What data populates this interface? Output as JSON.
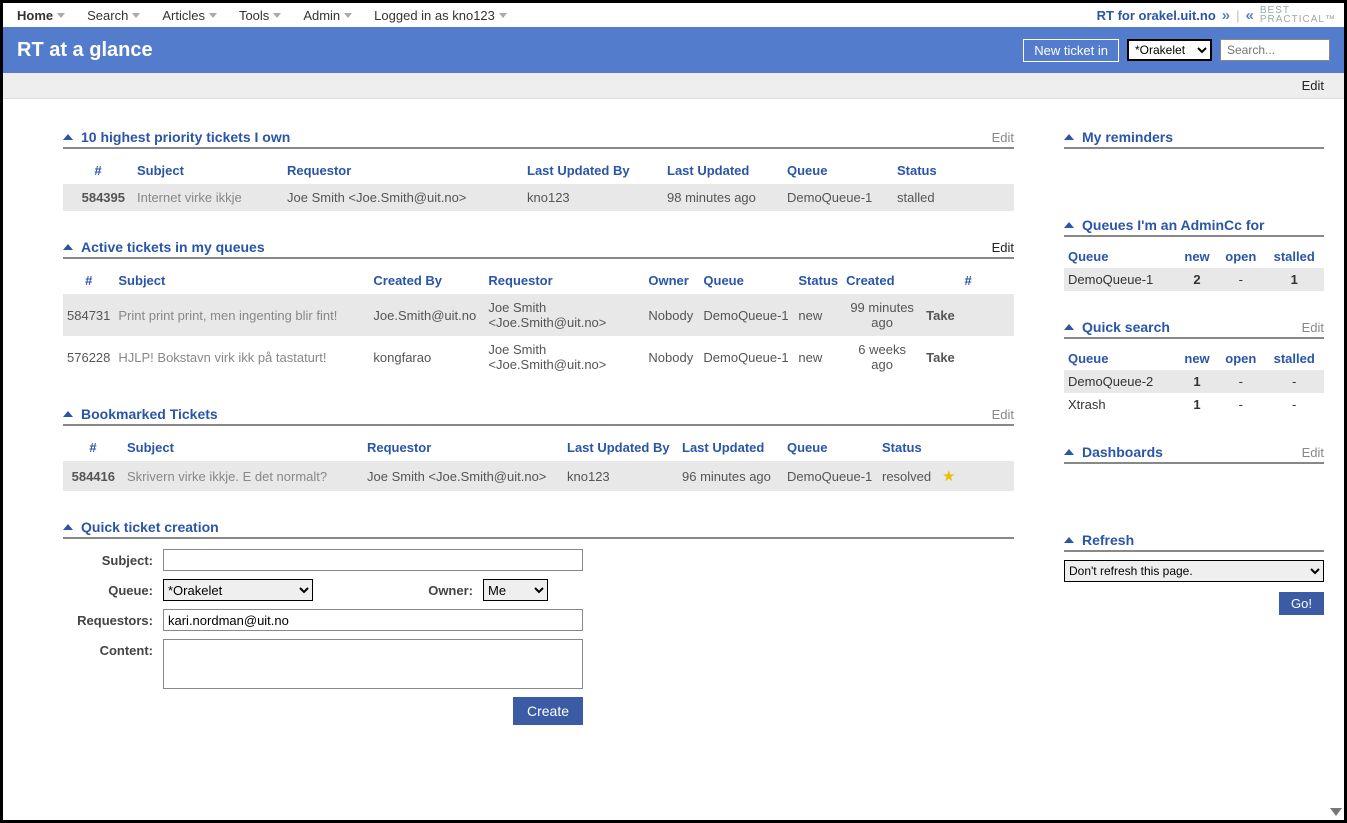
{
  "nav": {
    "items": [
      {
        "label": "Home"
      },
      {
        "label": "Search"
      },
      {
        "label": "Articles"
      },
      {
        "label": "Tools"
      },
      {
        "label": "Admin"
      },
      {
        "label": "Logged in as kno123"
      }
    ],
    "rt_for": "RT for orakel.uit.no",
    "logo_top": "BEST",
    "logo_bottom": "PRACTICAL™"
  },
  "header": {
    "title": "RT at a glance",
    "new_ticket": "New ticket in",
    "queue_options": [
      "*Orakelet"
    ],
    "search_placeholder": "Search..."
  },
  "subbar": {
    "edit": "Edit"
  },
  "highest": {
    "title": "10 highest priority tickets I own",
    "edit": "Edit",
    "cols": {
      "num": "#",
      "subject": "Subject",
      "requestor": "Requestor",
      "lub": "Last Updated By",
      "lu": "Last Updated",
      "queue": "Queue",
      "status": "Status"
    },
    "rows": [
      {
        "id": "584395",
        "subject": "Internet virke ikkje",
        "requestor": "Joe Smith <Joe.Smith@uit.no>",
        "lub": "kno123",
        "lu": "98 minutes ago",
        "queue": "DemoQueue-1",
        "status": "stalled"
      }
    ]
  },
  "active": {
    "title": "Active tickets in my queues",
    "edit": "Edit",
    "cols": {
      "num": "#",
      "subject": "Subject",
      "cb": "Created By",
      "requestor": "Requestor",
      "owner": "Owner",
      "queue": "Queue",
      "status": "Status",
      "created": "Created",
      "link": "#"
    },
    "rows": [
      {
        "id": "584731",
        "subject": "Print print print, men ingenting blir fint!",
        "cb": "Joe.Smith@uit.no",
        "requestor": "Joe Smith <Joe.Smith@uit.no>",
        "owner": "Nobody",
        "queue": "DemoQueue-1",
        "status": "new",
        "created": "99 minutes ago",
        "take": "Take"
      },
      {
        "id": "576228",
        "subject": "HJLP! Bokstavn virk ikk på tastaturt!",
        "cb": "kongfarao",
        "requestor": "Joe Smith <Joe.Smith@uit.no>",
        "owner": "Nobody",
        "queue": "DemoQueue-1",
        "status": "new",
        "created": "6 weeks ago",
        "take": "Take"
      }
    ]
  },
  "bookmarked": {
    "title": "Bookmarked Tickets",
    "edit": "Edit",
    "cols": {
      "num": "#",
      "subject": "Subject",
      "requestor": "Requestor",
      "lub": "Last Updated By",
      "lu": "Last Updated",
      "queue": "Queue",
      "status": "Status"
    },
    "rows": [
      {
        "id": "584416",
        "subject": "Skrivern virke ikkje. E det normalt?",
        "requestor": "Joe Smith <Joe.Smith@uit.no>",
        "lub": "kno123",
        "lu": "96 minutes ago",
        "queue": "DemoQueue-1",
        "status": "resolved"
      }
    ]
  },
  "quick_create": {
    "title": "Quick ticket creation",
    "subject_label": "Subject:",
    "queue_label": "Queue:",
    "owner_label": "Owner:",
    "requestors_label": "Requestors:",
    "content_label": "Content:",
    "subject_value": "",
    "queue_value": "*Orakelet",
    "owner_value": "Me",
    "requestors_value": "kari.nordman@uit.no",
    "content_value": "",
    "create": "Create"
  },
  "reminders": {
    "title": "My reminders"
  },
  "admincc": {
    "title": "Queues I'm an AdminCc for",
    "cols": {
      "queue": "Queue",
      "new": "new",
      "open": "open",
      "stalled": "stalled"
    },
    "rows": [
      {
        "queue": "DemoQueue-1",
        "new": "2",
        "open": "-",
        "stalled": "1"
      }
    ]
  },
  "quicksearch": {
    "title": "Quick search",
    "edit": "Edit",
    "cols": {
      "queue": "Queue",
      "new": "new",
      "open": "open",
      "stalled": "stalled"
    },
    "rows": [
      {
        "queue": "DemoQueue-2",
        "new": "1",
        "open": "-",
        "stalled": "-"
      },
      {
        "queue": "Xtrash",
        "new": "1",
        "open": "-",
        "stalled": "-"
      }
    ]
  },
  "dashboards": {
    "title": "Dashboards",
    "edit": "Edit"
  },
  "refresh": {
    "title": "Refresh",
    "value": "Don't refresh this page.",
    "go": "Go!"
  }
}
